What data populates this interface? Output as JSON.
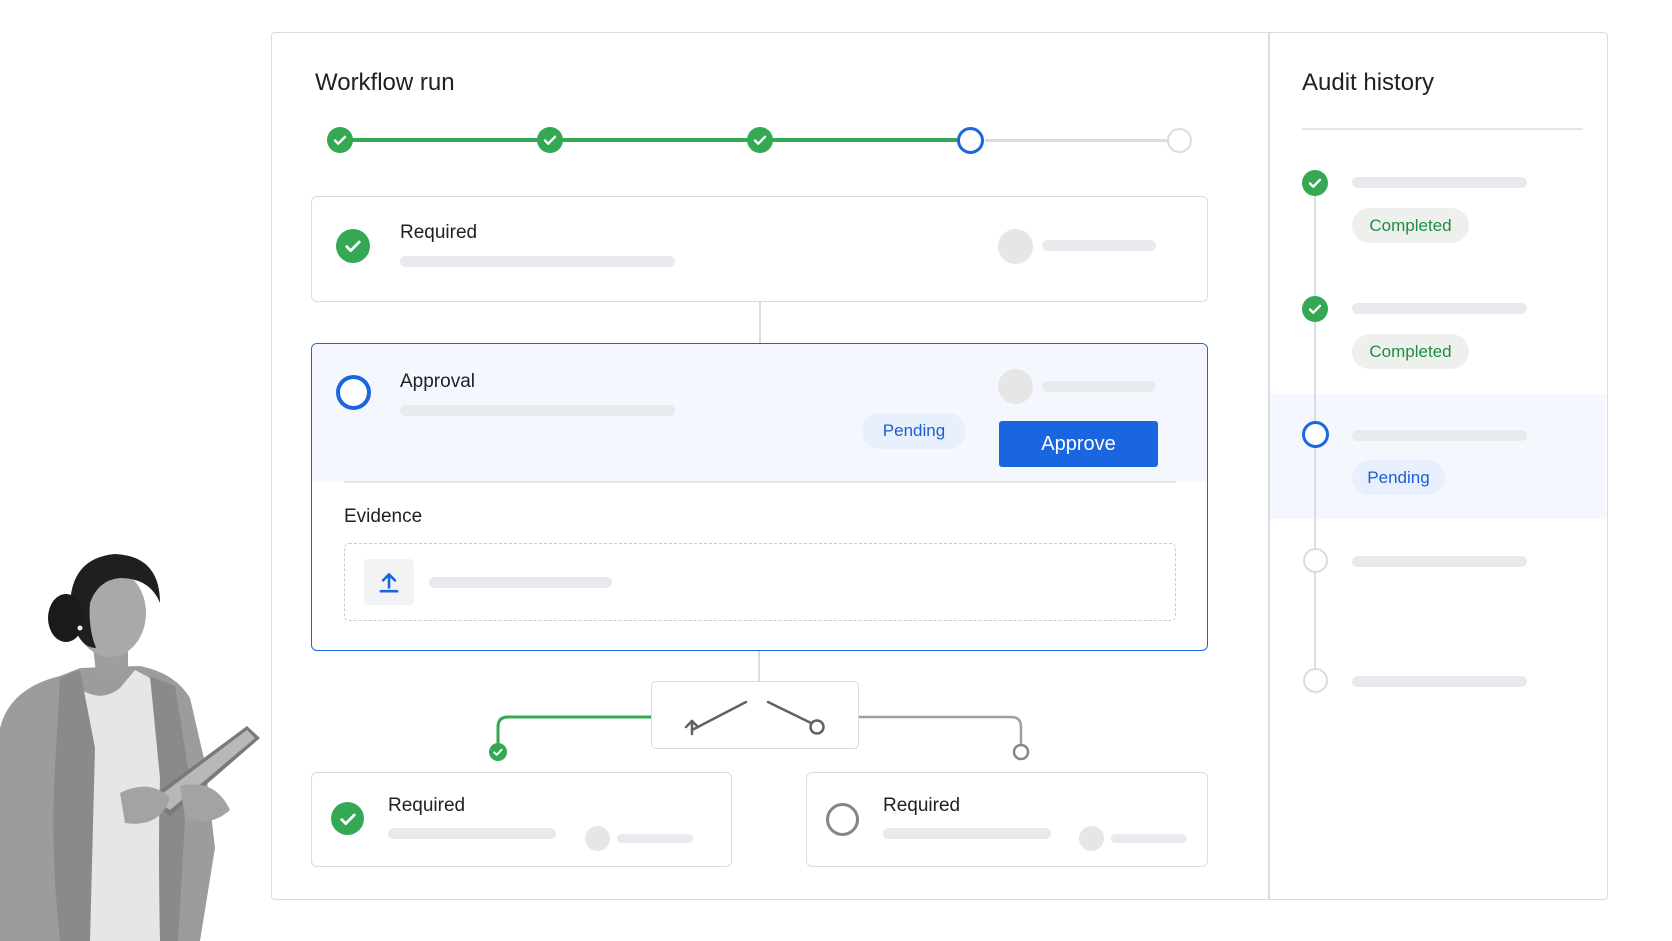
{
  "workflow": {
    "title": "Workflow run",
    "steps": [
      "completed",
      "completed",
      "completed",
      "current",
      "upcoming"
    ]
  },
  "cards": {
    "required_top": {
      "label": "Required",
      "status": "completed"
    },
    "approval": {
      "label": "Approval",
      "status_badge": "Pending",
      "approve_button": "Approve",
      "evidence_label": "Evidence"
    },
    "branch_left": {
      "label": "Required",
      "status": "completed"
    },
    "branch_right": {
      "label": "Required",
      "status": "not-started"
    }
  },
  "audit": {
    "title": "Audit history",
    "entries": [
      {
        "status": "completed",
        "badge": "Completed"
      },
      {
        "status": "completed",
        "badge": "Completed"
      },
      {
        "status": "pending",
        "badge": "Pending"
      },
      {
        "status": "upcoming",
        "badge": ""
      },
      {
        "status": "upcoming",
        "badge": ""
      }
    ]
  },
  "colors": {
    "green": "#34a853",
    "blue": "#1a66e0",
    "gray_line": "#dadce0",
    "highlight_bg": "#f4f7fd"
  },
  "icons": [
    "check-icon",
    "upload-icon",
    "branch-icon"
  ]
}
